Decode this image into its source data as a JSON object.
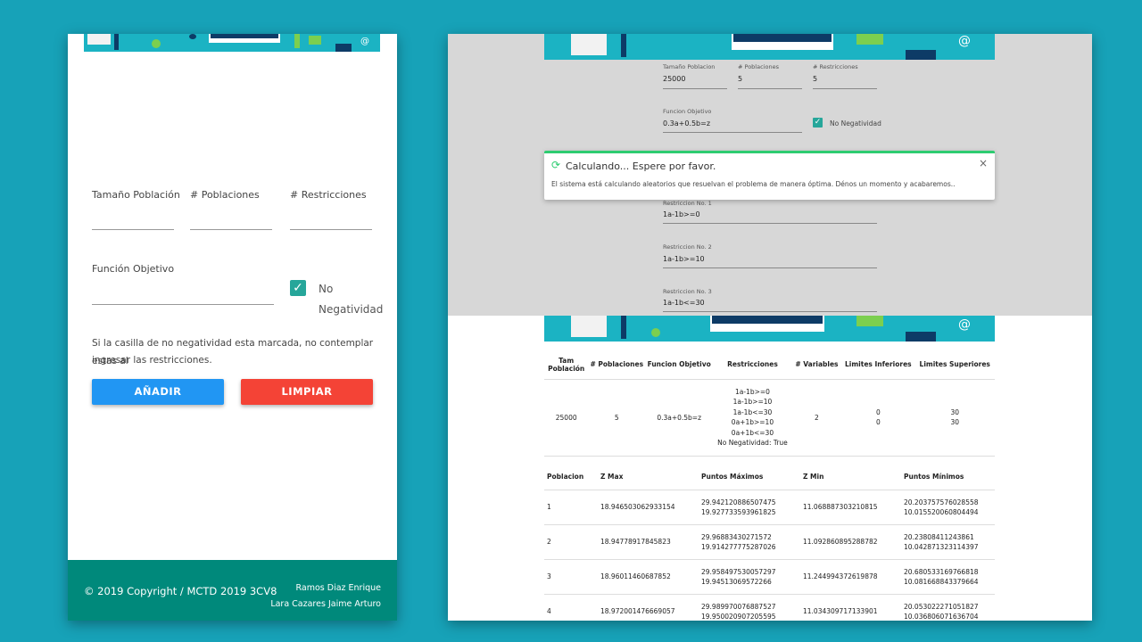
{
  "left_form": {
    "labels": {
      "population_size": "Tamaño Población",
      "num_populations": "# Poblaciones",
      "num_restrictions": "# Restricciones",
      "objective_function": "Función Objetivo"
    },
    "no_negativity_line1": "No",
    "no_negativity_line2": "Negatividad",
    "no_negativity_checked": true,
    "note_line1": "Si la casilla de no negatividad esta marcada, no contemplar estas al",
    "note_line2": "ingresar las restricciones.",
    "add_button": "AÑADIR",
    "clear_button": "LIMPIAR"
  },
  "footer": {
    "copyright": "© 2019 Copyright / MCTD 2019 3CV8",
    "author1": "Ramos Diaz Enrique",
    "author2": "Lara Cazares Jaime Arturo"
  },
  "right_form": {
    "labels": {
      "population_size": "Tamaño Poblacion",
      "num_populations": "# Poblaciones",
      "num_restrictions": "# Restricciones",
      "objective_function": "Funcion Objetivo",
      "no_negativity": "No Negatividad"
    },
    "values": {
      "population_size": "25000",
      "num_populations": "5",
      "num_restrictions": "5",
      "objective_function": "0.3a+0.5b=z"
    },
    "restrictions": [
      {
        "label": "Restriccion No. 1",
        "value": "1a-1b>=0"
      },
      {
        "label": "Restriccion No. 2",
        "value": "1a-1b>=10"
      },
      {
        "label": "Restriccion No. 3",
        "value": "1a-1b<=30"
      }
    ]
  },
  "toast": {
    "title": "Calculando... Espere por favor.",
    "message": "El sistema está calculando aleatorios que resuelvan el problema de manera óptima. Dénos un momento y acabaremos..",
    "close": "×"
  },
  "summary_table": {
    "headers": [
      "Tam Población",
      "# Poblaciones",
      "Funcion Objetivo",
      "Restricciones",
      "# Variables",
      "Limites Inferiores",
      "Limites Superiores"
    ],
    "row": {
      "population": "25000",
      "populations": "5",
      "objective": "0.3a+0.5b=z",
      "restrictions": [
        "1a-1b>=0",
        "1a-1b>=10",
        "1a-1b<=30",
        "0a+1b>=10",
        "0a+1b<=30",
        "No Negatividad: True"
      ],
      "variables": "2",
      "lower_limits": [
        "0",
        "0"
      ],
      "upper_limits": [
        "30",
        "30"
      ]
    }
  },
  "results_table": {
    "headers": [
      "Poblacion",
      "Z Max",
      "Puntos Máximos",
      "Z Min",
      "Puntos Mínimos"
    ],
    "rows": [
      {
        "pop": "1",
        "zmax": "18.946503062933154",
        "pmax": [
          "29.942120886507475",
          "19.927733593961825"
        ],
        "zmin": "11.068887303210815",
        "pmin": [
          "20.203757576028558",
          "10.015520060804494"
        ]
      },
      {
        "pop": "2",
        "zmax": "18.94778917845823",
        "pmax": [
          "29.96883430271572",
          "19.914277775287026"
        ],
        "zmin": "11.092860895288782",
        "pmin": [
          "20.23808411243861",
          "10.042871323114397"
        ]
      },
      {
        "pop": "3",
        "zmax": "18.96011460687852",
        "pmax": [
          "29.958497530057297",
          "19.94513069572266"
        ],
        "zmin": "11.244994372619878",
        "pmin": [
          "20.680533169766818",
          "10.081668843379664"
        ]
      },
      {
        "pop": "4",
        "zmax": "18.972001476669057",
        "pmax": [
          "29.989970076887527",
          "19.950020907205595"
        ],
        "zmin": "11.034309717133901",
        "pmin": [
          "20.053022271051827",
          "10.036806071636704"
        ]
      }
    ]
  }
}
